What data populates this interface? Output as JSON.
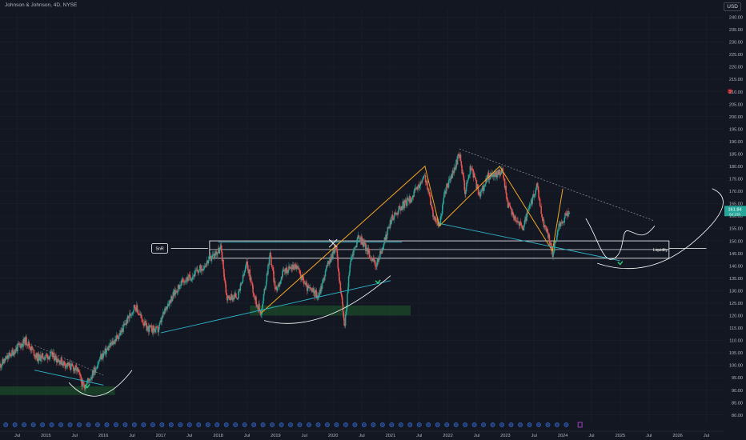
{
  "header": {
    "title": "Johnson & Johnson, 4D, NYSE",
    "currency": "USD"
  },
  "colors": {
    "background": "#131722",
    "grid": "#1c2030",
    "up": "#26a69a",
    "down": "#ef5350",
    "trendline": "#2fb3c8",
    "zigzag": "#f6a623",
    "price_badge": "#26a69a"
  },
  "chart_data": {
    "type": "candlestick",
    "title": "Johnson & Johnson, 4D, NYSE",
    "ylabel": "USD",
    "ylim": [
      77,
      243
    ],
    "y_ticks": [
      80,
      85,
      90,
      95,
      100,
      105,
      110,
      115,
      120,
      125,
      130,
      135,
      140,
      145,
      150,
      155,
      160,
      165,
      170,
      175,
      180,
      185,
      190,
      195,
      200,
      205,
      210,
      215,
      220,
      225,
      230,
      235,
      240
    ],
    "x_ticks": [
      {
        "label": "Jul",
        "t": 2014.5
      },
      {
        "label": "2015",
        "t": 2015.0
      },
      {
        "label": "Jul",
        "t": 2015.5
      },
      {
        "label": "2016",
        "t": 2016.0
      },
      {
        "label": "Jul",
        "t": 2016.5
      },
      {
        "label": "2017",
        "t": 2017.0
      },
      {
        "label": "Jul",
        "t": 2017.5
      },
      {
        "label": "2018",
        "t": 2018.0
      },
      {
        "label": "Jul",
        "t": 2018.5
      },
      {
        "label": "2019",
        "t": 2019.0
      },
      {
        "label": "Jul",
        "t": 2019.5
      },
      {
        "label": "2020",
        "t": 2020.0
      },
      {
        "label": "Jul",
        "t": 2020.5
      },
      {
        "label": "2021",
        "t": 2021.0
      },
      {
        "label": "Jul",
        "t": 2021.5
      },
      {
        "label": "2022",
        "t": 2022.0
      },
      {
        "label": "Jul",
        "t": 2022.5
      },
      {
        "label": "2023",
        "t": 2023.0
      },
      {
        "label": "Jul",
        "t": 2023.5
      },
      {
        "label": "2024",
        "t": 2024.0
      },
      {
        "label": "Jul",
        "t": 2024.5
      },
      {
        "label": "2025",
        "t": 2025.0
      },
      {
        "label": "Jul",
        "t": 2025.5
      },
      {
        "label": "2026",
        "t": 2026.0
      },
      {
        "label": "Jul",
        "t": 2026.5
      }
    ],
    "x_range": [
      2014.2,
      2026.8
    ],
    "price_path": [
      [
        2014.2,
        100
      ],
      [
        2014.5,
        107
      ],
      [
        2014.65,
        110
      ],
      [
        2014.85,
        103
      ],
      [
        2015.1,
        104
      ],
      [
        2015.3,
        101
      ],
      [
        2015.55,
        98
      ],
      [
        2015.65,
        91
      ],
      [
        2015.8,
        96
      ],
      [
        2015.95,
        103
      ],
      [
        2016.3,
        113
      ],
      [
        2016.55,
        124
      ],
      [
        2016.75,
        115
      ],
      [
        2016.95,
        114
      ],
      [
        2017.1,
        124
      ],
      [
        2017.35,
        133
      ],
      [
        2017.55,
        136
      ],
      [
        2017.75,
        140
      ],
      [
        2017.95,
        145
      ],
      [
        2018.05,
        147
      ],
      [
        2018.15,
        127
      ],
      [
        2018.35,
        128
      ],
      [
        2018.5,
        141
      ],
      [
        2018.65,
        126
      ],
      [
        2018.75,
        121
      ],
      [
        2018.9,
        145
      ],
      [
        2019.0,
        130
      ],
      [
        2019.15,
        138
      ],
      [
        2019.35,
        140
      ],
      [
        2019.55,
        131
      ],
      [
        2019.75,
        128
      ],
      [
        2019.9,
        140
      ],
      [
        2020.05,
        148
      ],
      [
        2020.2,
        115
      ],
      [
        2020.3,
        142
      ],
      [
        2020.45,
        152
      ],
      [
        2020.6,
        146
      ],
      [
        2020.75,
        140
      ],
      [
        2020.9,
        150
      ],
      [
        2021.0,
        158
      ],
      [
        2021.15,
        163
      ],
      [
        2021.35,
        167
      ],
      [
        2021.5,
        172
      ],
      [
        2021.6,
        176
      ],
      [
        2021.75,
        160
      ],
      [
        2021.85,
        156
      ],
      [
        2021.95,
        170
      ],
      [
        2022.1,
        178
      ],
      [
        2022.2,
        185
      ],
      [
        2022.3,
        170
      ],
      [
        2022.4,
        180
      ],
      [
        2022.55,
        168
      ],
      [
        2022.7,
        176
      ],
      [
        2022.85,
        177
      ],
      [
        2022.95,
        178
      ],
      [
        2023.05,
        164
      ],
      [
        2023.15,
        160
      ],
      [
        2023.3,
        155
      ],
      [
        2023.45,
        165
      ],
      [
        2023.55,
        172
      ],
      [
        2023.65,
        158
      ],
      [
        2023.75,
        152
      ],
      [
        2023.82,
        145
      ],
      [
        2023.95,
        157
      ],
      [
        2024.05,
        160
      ],
      [
        2024.12,
        161.84
      ]
    ],
    "last_price": {
      "value": 161.84,
      "label": "161.84",
      "sublabel": "6d 23h"
    },
    "zones": [
      {
        "name": "liquidity-zone",
        "label": "Liquidity",
        "low": 143,
        "high": 150,
        "x_start": 2017.85,
        "x_end": 2025.85
      },
      {
        "name": "snr-label",
        "label": "SnR",
        "y": 147,
        "x": 2017.4
      }
    ],
    "annotations": {
      "snr": "SnR",
      "liquidity": "Liquidity"
    },
    "timeline_marker_count": 62
  }
}
